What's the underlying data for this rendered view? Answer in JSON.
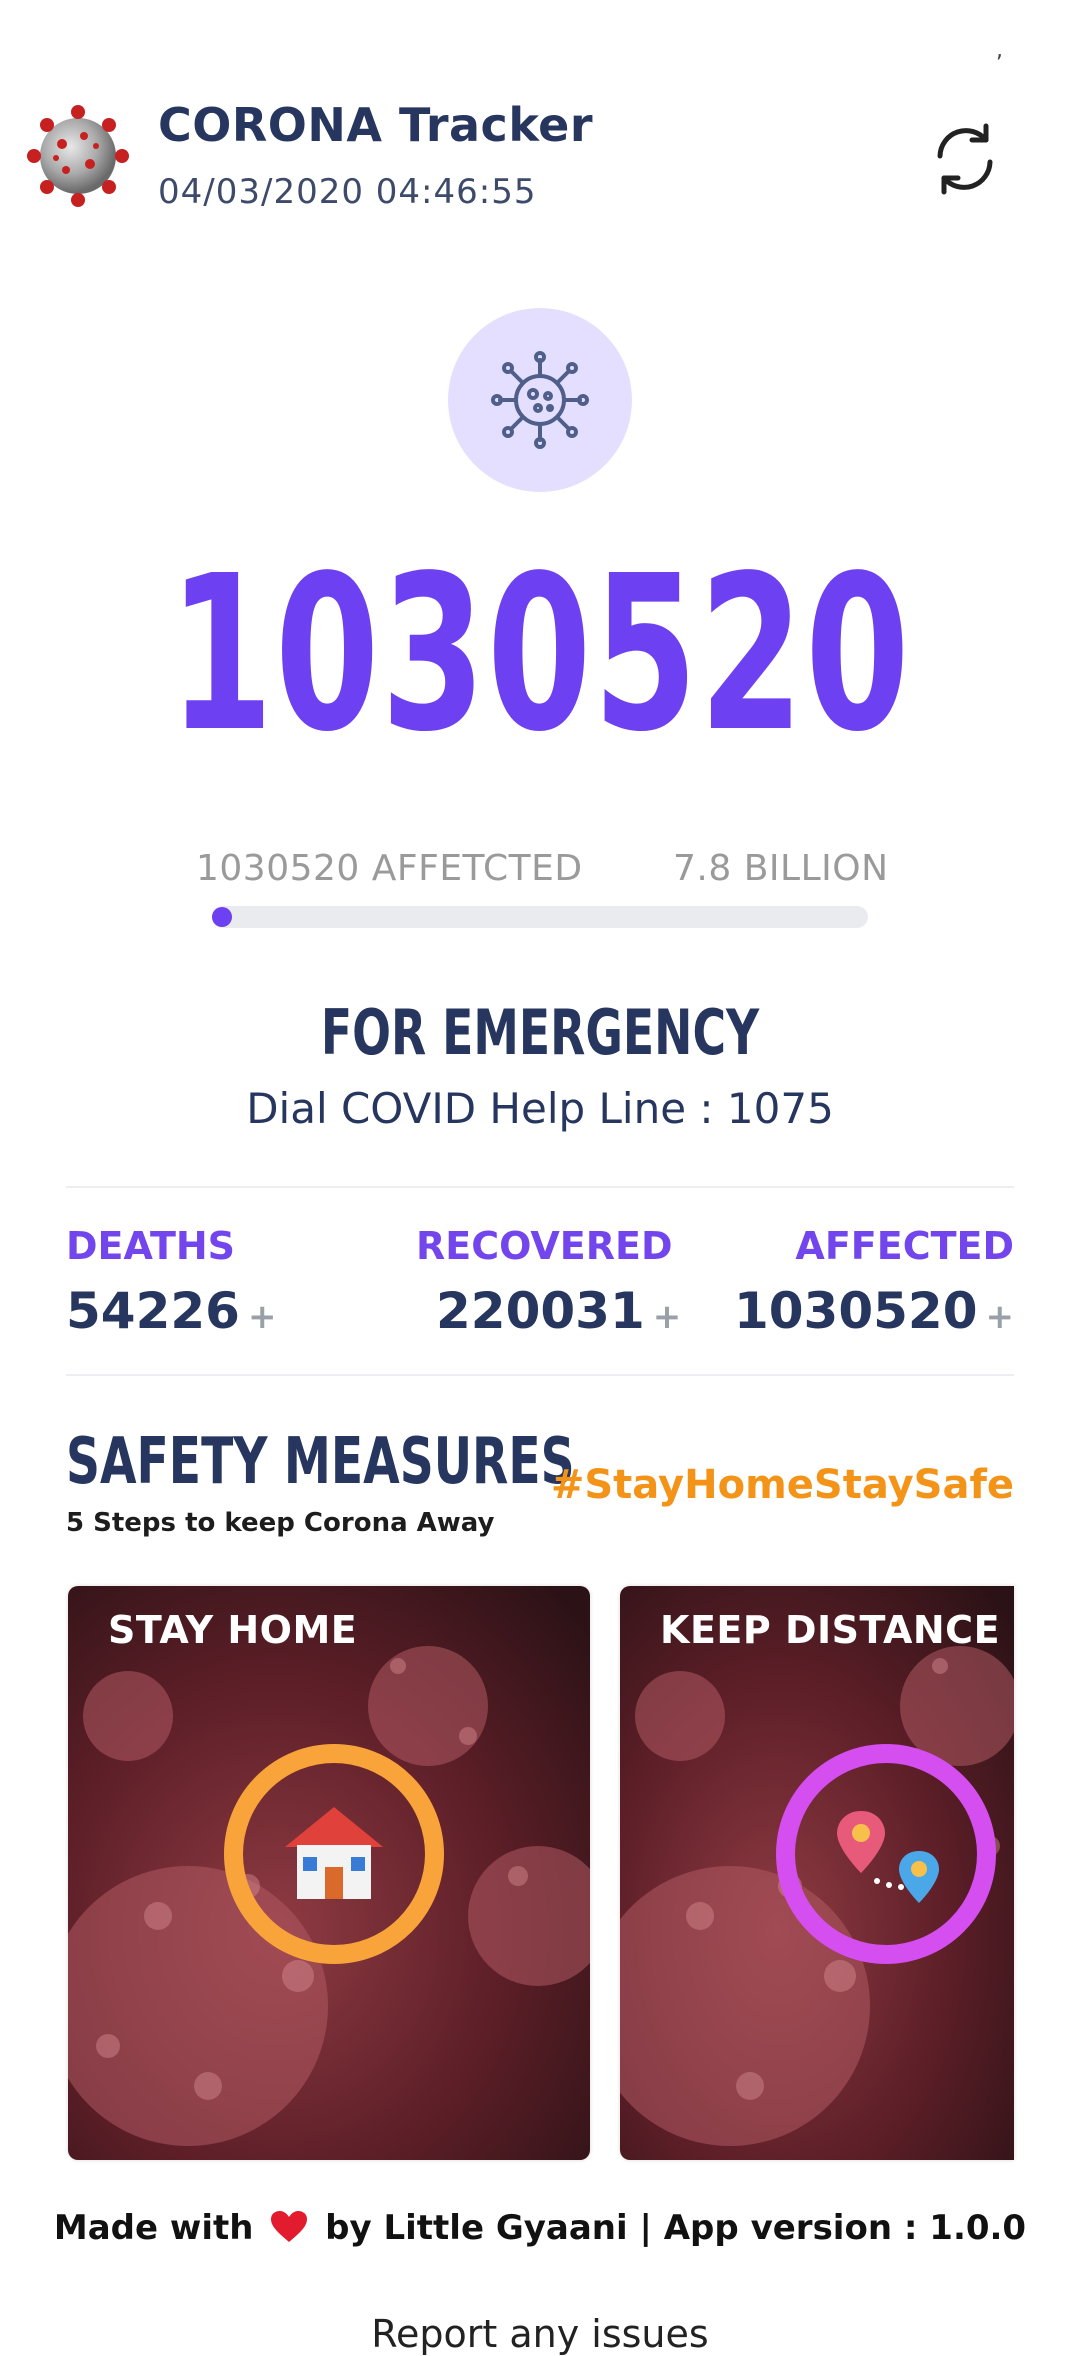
{
  "status": {
    "mark": ","
  },
  "header": {
    "title": "CORONA Tracker",
    "timestamp": "04/03/2020 04:46:55",
    "logo_icon": "coronavirus-logo",
    "refresh_icon": "refresh-icon"
  },
  "hero": {
    "icon": "virus-icon",
    "total": "1030520"
  },
  "progress": {
    "left_label": "1030520 AFFETCTED",
    "right_label": "7.8 BILLION",
    "fraction": 0.000132,
    "color": "#6d40f2"
  },
  "emergency": {
    "title": "FOR EMERGENCY",
    "line": "Dial COVID Help Line : 1075"
  },
  "stats": {
    "deaths": {
      "label": "DEATHS",
      "value": "54226",
      "plus": "+"
    },
    "recovered": {
      "label": "RECOVERED",
      "value": "220031",
      "plus": "+"
    },
    "affected": {
      "label": "AFFECTED",
      "value": "1030520",
      "plus": "+"
    }
  },
  "safety": {
    "title": "SAFETY MEASURES",
    "subtitle": "5 Steps to keep Corona Away",
    "hashtag": "#StayHomeStaySafe",
    "cards": [
      {
        "label": "STAY HOME",
        "icon": "house-icon",
        "ring_color": "#f9a43a"
      },
      {
        "label": "KEEP DISTANCE",
        "icon": "location-pins-icon",
        "ring_color": "#d54ef0"
      }
    ]
  },
  "footer": {
    "credit_before": "Made with",
    "credit_after": "by Little Gyaani | App version : 1.0.0",
    "heart_icon": "heart-icon",
    "report_link": "Report any issues"
  },
  "colors": {
    "accent": "#6d40f2",
    "navy": "#26365e",
    "orange": "#f39418"
  }
}
